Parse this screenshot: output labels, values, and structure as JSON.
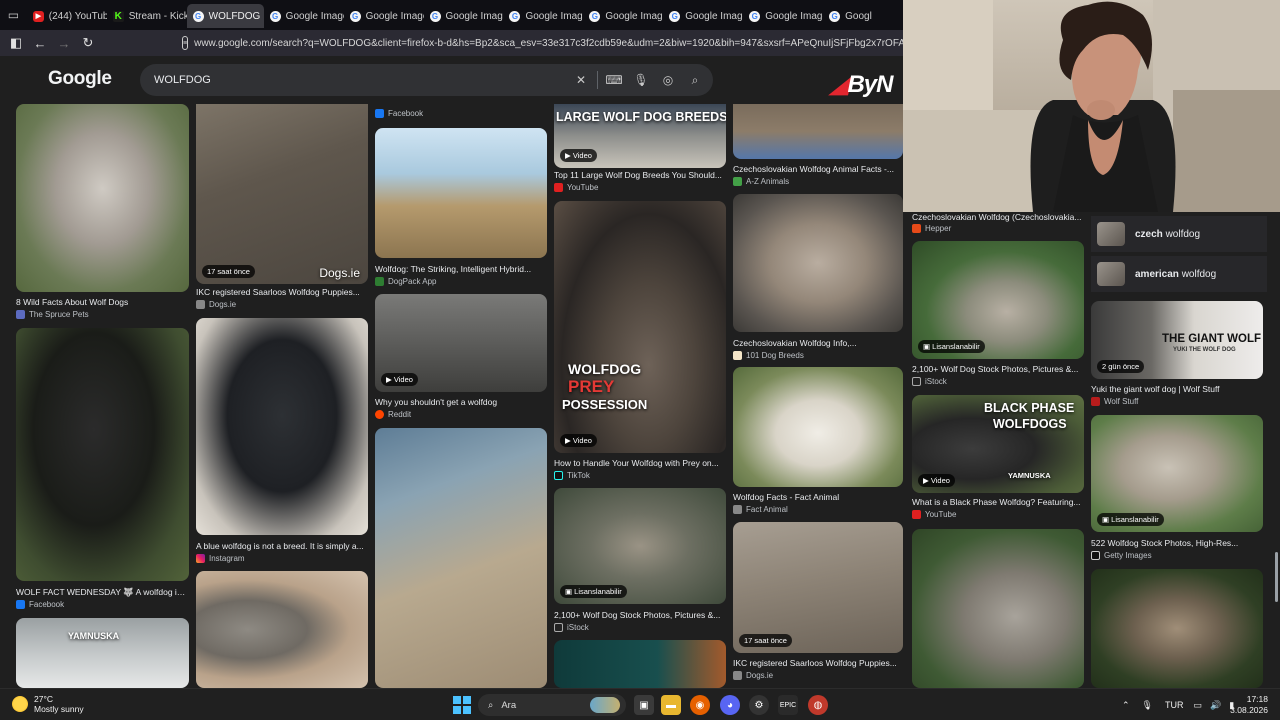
{
  "tabs": [
    {
      "label": "(244) YouTube",
      "icon": "youtube-icon",
      "active": false
    },
    {
      "label": "Stream - Kick D",
      "icon": "kick-icon",
      "active": false
    },
    {
      "label": "WOLFDOG",
      "icon": "google-icon",
      "active": true
    },
    {
      "label": "Google Image",
      "icon": "google-icon",
      "active": false
    },
    {
      "label": "Google Image",
      "icon": "google-icon",
      "active": false
    },
    {
      "label": "Google Image",
      "icon": "google-icon",
      "active": false
    },
    {
      "label": "Google Image",
      "icon": "google-icon",
      "active": false
    },
    {
      "label": "Google Image",
      "icon": "google-icon",
      "active": false
    },
    {
      "label": "Google Image",
      "icon": "google-icon",
      "active": false
    },
    {
      "label": "Google Image",
      "icon": "google-icon",
      "active": false
    },
    {
      "label": "Googl",
      "icon": "google-icon",
      "active": false
    }
  ],
  "url": "www.google.com/search?q=WOLFDOG&client=firefox-b-d&hs=Bp2&sca_esv=33e317c3f2cdb59e&udm=2&biw=1920&bih=947&sxsrf=APeQnuIjSFjFbg2x7rOFAmDWzU",
  "google": {
    "logo": "Google",
    "query": "WOLFDOG",
    "ad_brand": "ByN"
  },
  "results": {
    "c1r1": {
      "title": "8 Wild Facts About Wolf Dogs",
      "source": "The Spruce Pets"
    },
    "c1r2": {
      "title": "WOLF FACT WEDNESDAY 🐺 A wolfdog is ...",
      "source": "Facebook"
    },
    "c1r3": {
      "overlay": "YAMNUSKA"
    },
    "c2r1": {
      "title": "IKC registered Saarloos Wolfdog Puppies...",
      "source": "Dogs.ie",
      "badge": "17 saat önce",
      "watermark": "Dogs.ie"
    },
    "c2r2": {
      "title": "A blue wolfdog is not a breed. It is simply a...",
      "source": "Instagram"
    },
    "c3r0": {
      "source": "Facebook"
    },
    "c3r1": {
      "title": "Wolfdog: The Striking, Intelligent Hybrid...",
      "source": "DogPack App"
    },
    "c3r2": {
      "title": "Why you shouldn't get a wolfdog",
      "source": "Reddit",
      "badge": "Video"
    },
    "c4r1": {
      "title": "Top 11 Large Wolf Dog Breeds You Should...",
      "source": "YouTube",
      "badge": "Video",
      "overlay": "LARGE WOLF DOG BREEDS"
    },
    "c4r2": {
      "title": "How to Handle Your Wolfdog with Prey on...",
      "source": "TikTok",
      "badge": "Video",
      "overlay1": "WOLFDOG",
      "overlay2": "PREY",
      "overlay3": "POSSESSION"
    },
    "c4r3": {
      "title": "2,100+ Wolf Dog Stock Photos, Pictures &...",
      "source": "iStock",
      "badge": "Lisanslanabilir"
    },
    "c5r0": {
      "title": "Czechoslovakian Wolfdog Animal Facts -...",
      "source": "A-Z Animals"
    },
    "c5r1": {
      "title": "Czechoslovakian Wolfdog Info,...",
      "source": "101 Dog Breeds"
    },
    "c5r2": {
      "title": "Wolfdog Facts - Fact Animal",
      "source": "Fact Animal"
    },
    "c5r3": {
      "title": "IKC registered Saarloos Wolfdog Puppies...",
      "source": "Dogs.ie",
      "badge": "17 saat önce"
    },
    "c6r0": {
      "title": "Czechoslovakian Wolfdog (Czechoslovakia...",
      "source": "Hepper"
    },
    "c6r1": {
      "title": "2,100+ Wolf Dog Stock Photos, Pictures &...",
      "source": "iStock",
      "badge": "Lisanslanabilir"
    },
    "c6r2": {
      "title": "What is a Black Phase Wolfdog? Featuring...",
      "source": "YouTube",
      "badge": "Video",
      "overlay1": "BLACK PHASE",
      "overlay2": "WOLFDOGS",
      "overlay3": "YAMNUSKA"
    },
    "c7r1": {
      "title": "Yuki the giant wolf dog | Wolf Stuff",
      "source": "Wolf Stuff",
      "badge": "2 gün önce",
      "overlay1": "THE GIANT WOLF",
      "overlay2": "YUKI THE WOLF DOG"
    },
    "c7r2": {
      "title": "522 Wolfdog Stock Photos, High-Res...",
      "source": "Getty Images",
      "badge": "Lisanslanabilir"
    }
  },
  "suggestions": [
    {
      "bold": "czech",
      "rest": " wolfdog"
    },
    {
      "bold": "american",
      "rest": " wolfdog"
    }
  ],
  "taskbar": {
    "temp": "27°C",
    "weather": "Mostly sunny",
    "search": "Ara",
    "lang": "TUR",
    "time": "17:18",
    "date": "3.08.2026"
  }
}
